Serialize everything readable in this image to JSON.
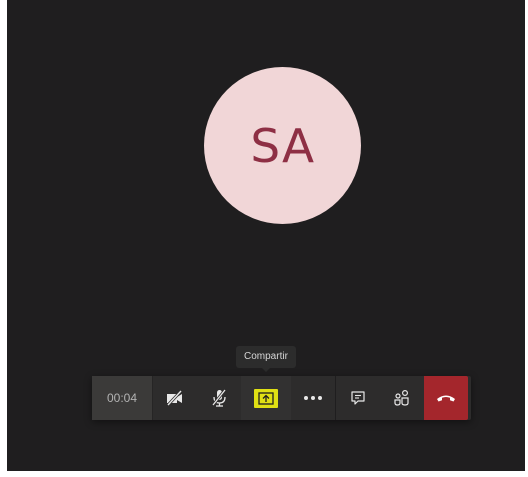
{
  "participant": {
    "initials": "SA",
    "avatar_bg": "#f1d6d7",
    "avatar_fg": "#8e2f44"
  },
  "tooltip": {
    "text": "Compartir"
  },
  "toolbar": {
    "timer": "00:04",
    "buttons": [
      {
        "icon": "camera-off-icon"
      },
      {
        "icon": "mic-off-icon"
      },
      {
        "icon": "share-screen-icon",
        "highlight": "#e0e014"
      },
      {
        "icon": "more-options-icon"
      },
      {
        "icon": "chat-icon"
      },
      {
        "icon": "participants-icon"
      },
      {
        "icon": "hang-up-icon",
        "color": "#a4262c"
      }
    ]
  }
}
